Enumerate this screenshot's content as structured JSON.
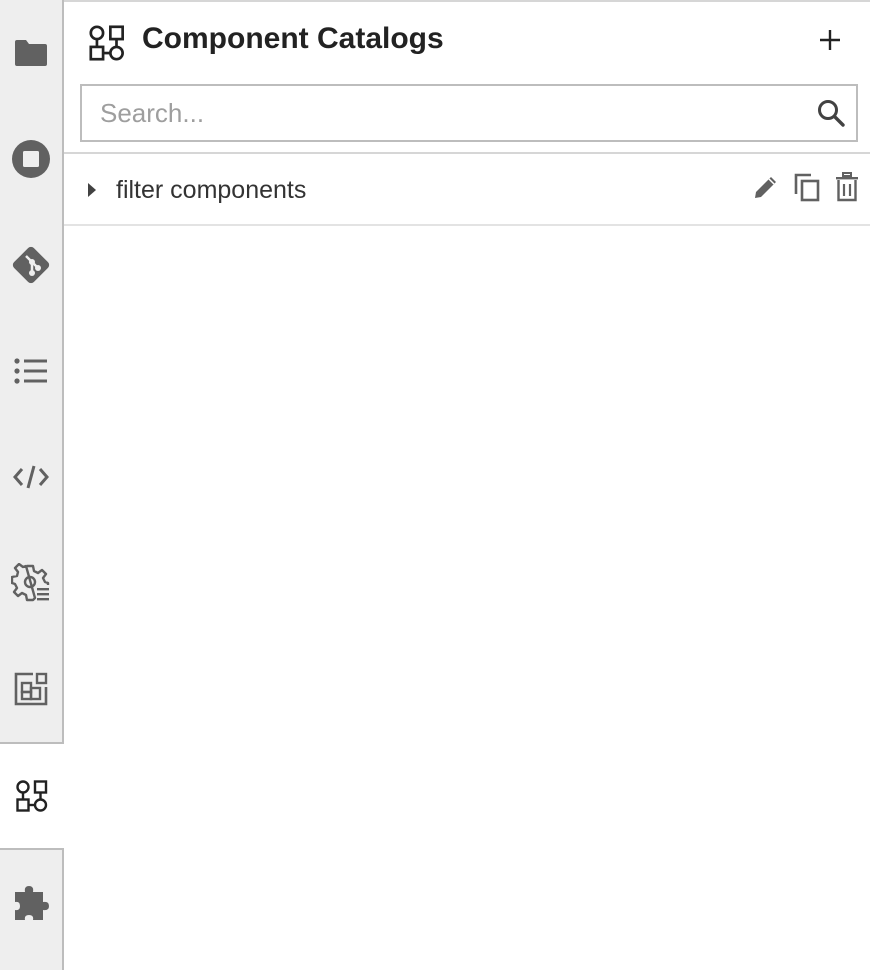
{
  "activity_bar": {
    "tabs": [
      {
        "name": "file-browser",
        "icon": "folder-icon"
      },
      {
        "name": "running-sessions",
        "icon": "stop-circle-icon"
      },
      {
        "name": "git",
        "icon": "git-icon"
      },
      {
        "name": "table-of-contents",
        "icon": "list-icon"
      },
      {
        "name": "code-snippets",
        "icon": "code-icon"
      },
      {
        "name": "runtimes",
        "icon": "settings-list-icon"
      },
      {
        "name": "runtime-images",
        "icon": "image-build-icon"
      },
      {
        "name": "component-catalogs",
        "icon": "component-catalog-icon",
        "active": true
      },
      {
        "name": "extensions",
        "icon": "puzzle-icon"
      }
    ]
  },
  "panel": {
    "title": "Component Catalogs",
    "header_icon": "component-catalog-icon",
    "add_icon": "plus-icon"
  },
  "search": {
    "placeholder": "Search...",
    "value": "",
    "icon": "search-icon"
  },
  "catalogs": [
    {
      "label": "filter components",
      "expanded": false,
      "actions": [
        "edit-icon",
        "copy-icon",
        "trash-icon"
      ]
    }
  ],
  "colors": {
    "activity_bar_bg": "#eeeeee",
    "icon": "#616161",
    "icon_active": "#222222",
    "border": "#bdbdbd"
  }
}
